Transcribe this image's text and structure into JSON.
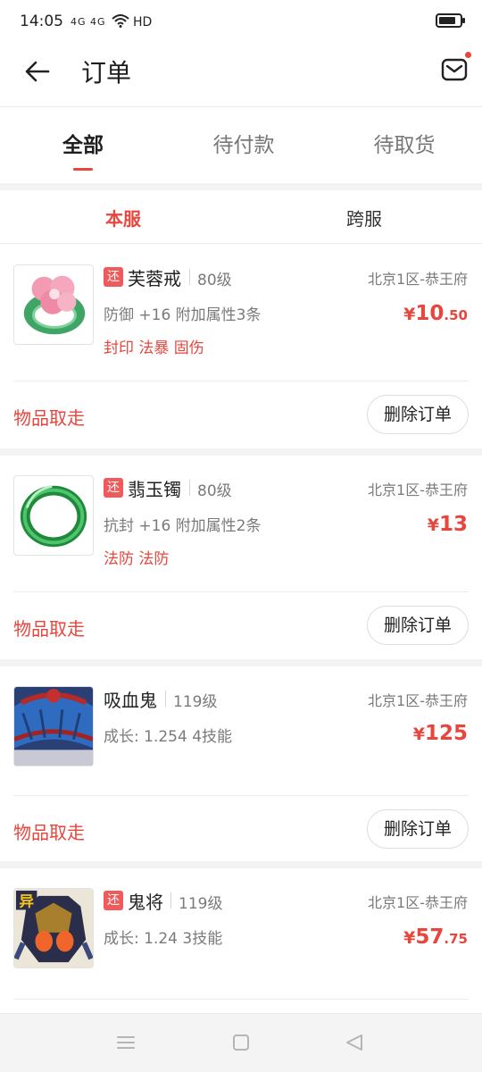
{
  "status_bar": {
    "time": "14:05",
    "signal": "4G 4G",
    "network": "HD",
    "battery_level_percent": 80
  },
  "header": {
    "title": "订单",
    "back_icon": "arrow-left-icon",
    "mail_icon": "mail-icon",
    "mail_has_unread": true
  },
  "tabs": [
    {
      "label": "全部",
      "active": true
    },
    {
      "label": "待付款",
      "active": false
    },
    {
      "label": "待取货",
      "active": false
    }
  ],
  "subtabs": [
    {
      "label": "本服",
      "active": true
    },
    {
      "label": "跨服",
      "active": false
    }
  ],
  "orders": [
    {
      "badge": "还",
      "name": "芙蓉戒",
      "level": "80级",
      "server": "北京1区-恭王府",
      "attr": "防御 +16  附加属性3条",
      "tags": "封印 法暴 固伤",
      "price_yen": "¥",
      "price_int": "10",
      "price_dec": ".50",
      "status": "物品取走",
      "delete_label": "删除订单",
      "image": "lotus-ring"
    },
    {
      "badge": "还",
      "name": "翡玉镯",
      "level": "80级",
      "server": "北京1区-恭王府",
      "attr": "抗封 +16  附加属性2条",
      "tags": "法防 法防",
      "price_yen": "¥",
      "price_int": "13",
      "price_dec": "",
      "status": "物品取走",
      "delete_label": "删除订单",
      "image": "jade-bracelet"
    },
    {
      "badge": "",
      "name": "吸血鬼",
      "level": "119级",
      "server": "北京1区-恭王府",
      "attr": "成长: 1.254  4技能",
      "tags": "",
      "price_yen": "¥",
      "price_int": "125",
      "price_dec": "",
      "status": "物品取走",
      "delete_label": "删除订单",
      "image": "vampire-pet"
    },
    {
      "badge": "还",
      "name": "鬼将",
      "level": "119级",
      "server": "北京1区-恭王府",
      "attr": "成长: 1.24  3技能",
      "tags": "",
      "price_yen": "¥",
      "price_int": "57",
      "price_dec": ".75",
      "status": "",
      "delete_label": "",
      "image": "ghost-general-pet",
      "image_label": "异"
    }
  ],
  "nav_bar": {
    "menu_icon": "menu-icon",
    "home_icon": "home-square-icon",
    "back_icon": "back-triangle-icon"
  },
  "colors": {
    "accent": "#e8453c",
    "badge": "#f05a5a",
    "text_primary": "#222222",
    "text_secondary": "#7a7a7a",
    "band": "#f3f3f3"
  }
}
